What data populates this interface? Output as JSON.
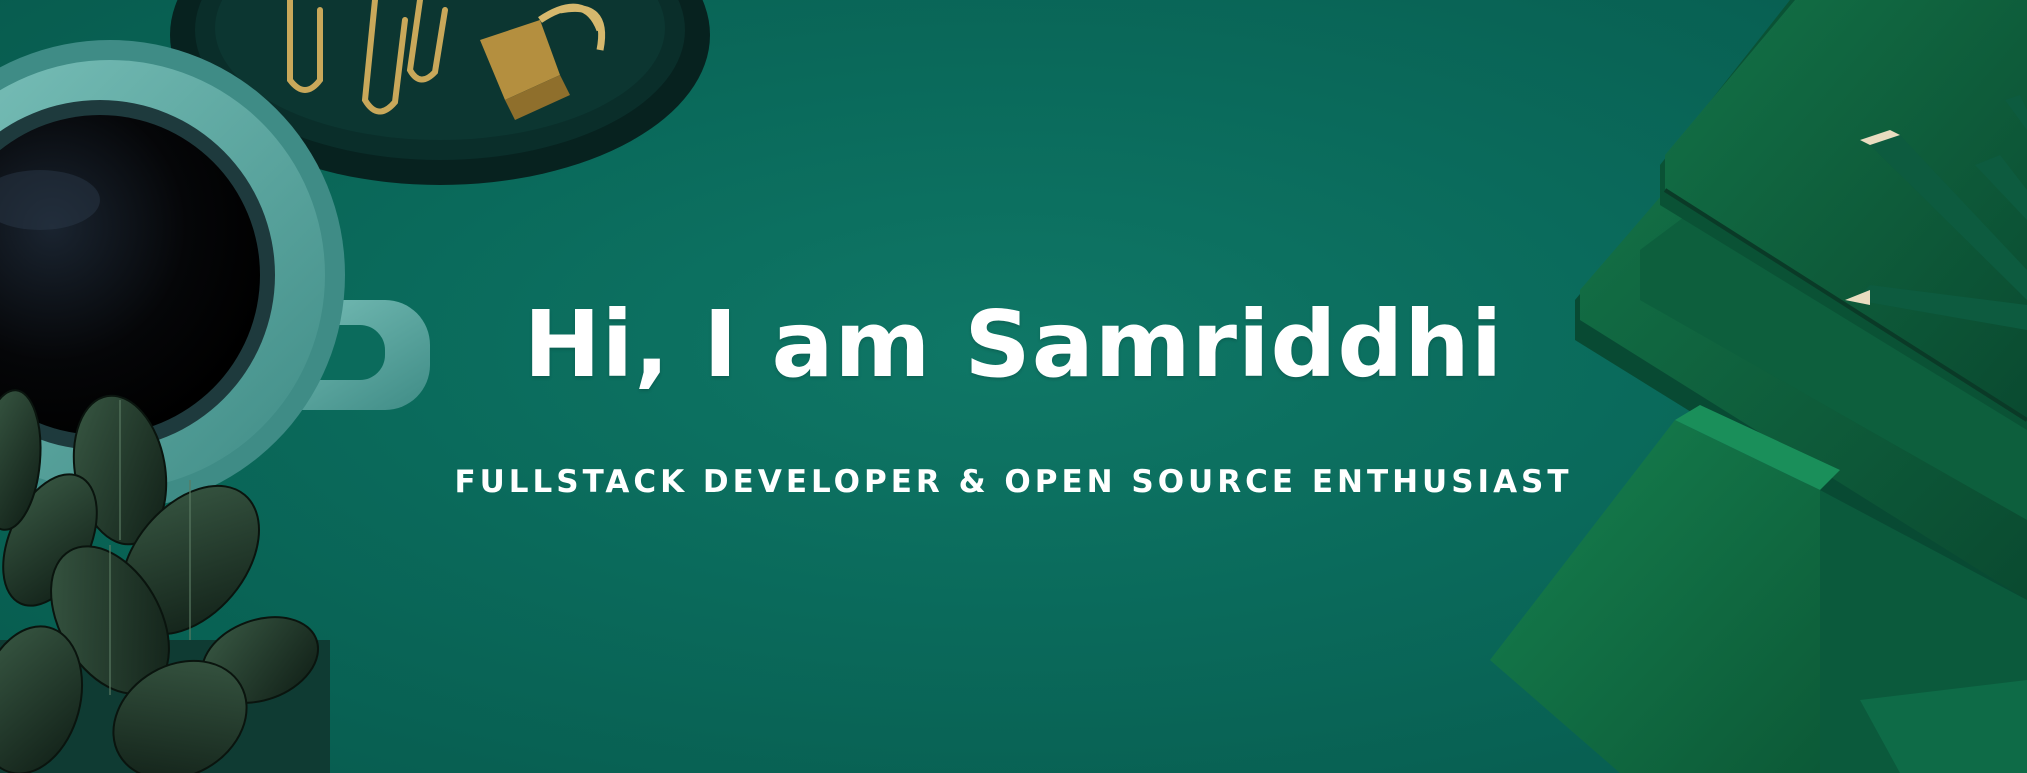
{
  "banner": {
    "headline": "Hi, I am Samriddhi",
    "tagline": "FULLSTACK DEVELOPER & OPEN SOURCE ENTHUSIAST"
  },
  "colors": {
    "background": "#0b6b5c",
    "text": "#ffffff",
    "mug": "#5fa9a2",
    "coffee": "#050608",
    "tray": "#0a2e2a",
    "clips": "#c9a85a",
    "notebook": "#0f5a3a",
    "pencil": "#0d5b3f",
    "leaves": "#1b2f22"
  },
  "decor": {
    "objects": [
      "paperclip-tray",
      "coffee-mug",
      "potted-plant",
      "notebook-stack",
      "pencils",
      "green-box"
    ]
  }
}
